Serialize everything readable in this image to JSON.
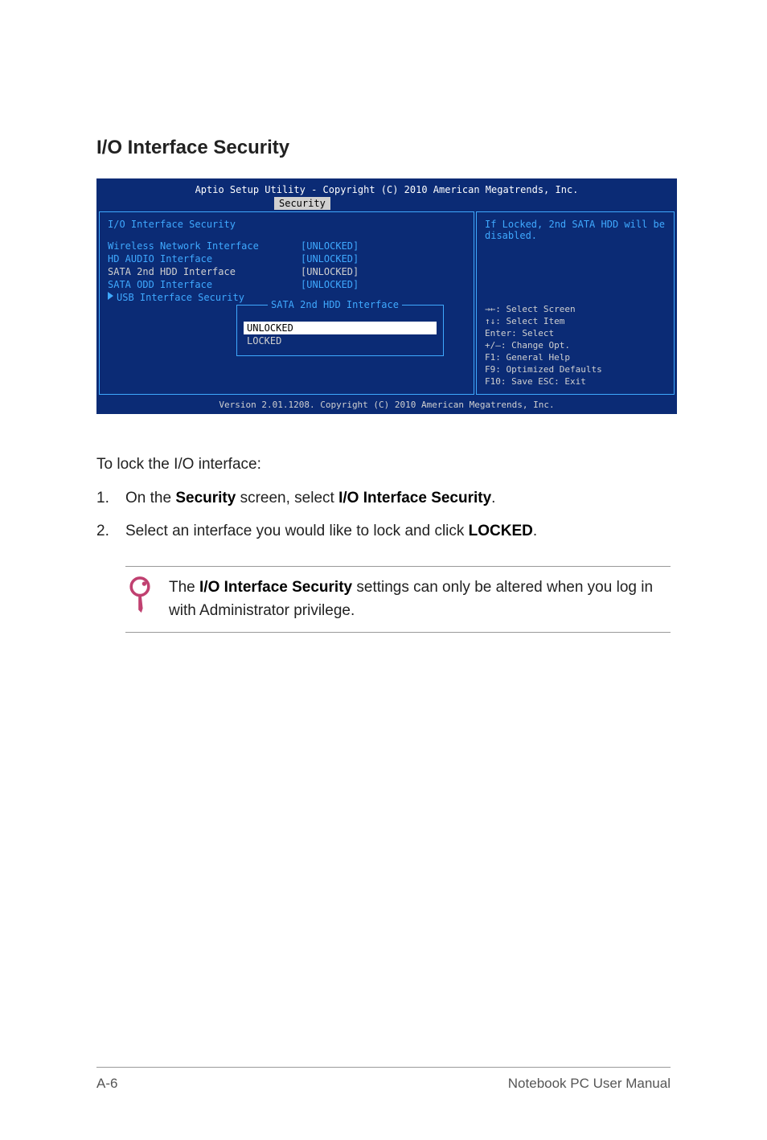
{
  "page": {
    "section_title": "I/O Interface Security",
    "page_number": "A-6",
    "manual_title": "Notebook PC User Manual"
  },
  "bios": {
    "header": "Aptio Setup Utility - Copyright (C) 2010 American Megatrends, Inc.",
    "tab": "Security",
    "panel_title": "I/O Interface Security",
    "items": [
      {
        "label": "Wireless Network Interface",
        "value": "[UNLOCKED]",
        "selected": false
      },
      {
        "label": "HD AUDIO Interface",
        "value": "[UNLOCKED]",
        "selected": false
      },
      {
        "label": "SATA 2nd HDD Interface",
        "value": "[UNLOCKED]",
        "selected": true
      },
      {
        "label": "SATA ODD Interface",
        "value": "[UNLOCKED]",
        "selected": false
      }
    ],
    "submenu": "USB Interface Security",
    "popup": {
      "title": "SATA 2nd HDD Interface",
      "options": [
        {
          "label": "UNLOCKED",
          "selected": true
        },
        {
          "label": "LOCKED",
          "selected": false
        }
      ]
    },
    "help_text": "If Locked, 2nd SATA HDD will be disabled.",
    "nav": {
      "l1": "→←: Select Screen",
      "l2": "↑↓:  Select Item",
      "l3": "Enter: Select",
      "l4": "+/—:  Change Opt.",
      "l5": "F1:   General Help",
      "l6": "F9:   Optimized Defaults",
      "l7": "F10:  Save   ESC: Exit"
    },
    "footer": "Version 2.01.1208. Copyright (C) 2010 American Megatrends, Inc."
  },
  "instructions": {
    "intro": "To lock the I/O interface:",
    "step1_num": "1.",
    "step1_a": "On the ",
    "step1_b": "Security",
    "step1_c": " screen, select ",
    "step1_d": "I/O Interface Security",
    "step1_e": ".",
    "step2_num": "2.",
    "step2_a": "Select an interface you would like to lock and click ",
    "step2_b": "LOCKED",
    "step2_c": ".",
    "note_a": "The ",
    "note_b": "I/O Interface Security",
    "note_c": " settings can only be altered when you log in with Administrator privilege."
  }
}
